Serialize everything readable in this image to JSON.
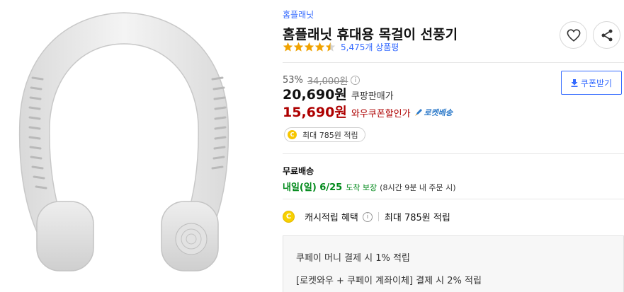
{
  "product": {
    "brand": "홈플래닛",
    "title": "홈플래닛 휴대용 목걸이 선풍기",
    "rating_count": "5,475개 상품평",
    "rating": 4.5,
    "star_color": "#f0a200"
  },
  "price": {
    "discount_rate": "53%",
    "original_price": "34,000원",
    "info_glyph": "i",
    "sale_price": "20,690원",
    "sale_label": "쿠팡판매가",
    "coupon_price": "15,690원",
    "coupon_label": "와우쿠폰할인가",
    "rocket_badge": "로켓배송",
    "price_color": "#ae0000"
  },
  "coupon_button": {
    "label": "쿠폰받기",
    "icon": "download-icon"
  },
  "reward": {
    "coin_glyph": "C",
    "label": "최대 785원 적립"
  },
  "shipping": {
    "title": "무료배송",
    "date": "내일(일) 6/25",
    "guarantee": "도착 보장",
    "note": "(8시간 9분 내 주문 시)",
    "color": "#00891a"
  },
  "benefit": {
    "coin_glyph": "C",
    "label": "캐시적립 혜택",
    "info_glyph": "i",
    "max_label": "최대 785원 적립",
    "lines": [
      "쿠페이 머니 결제 시 1% 적립",
      "[로켓와우 + 쿠페이 계좌이체] 결제 시 2% 적립"
    ]
  },
  "actions": {
    "wish_icon": "heart-icon",
    "share_icon": "share-icon"
  },
  "colors": {
    "accent": "#346aff",
    "coin": "#f7c600"
  }
}
